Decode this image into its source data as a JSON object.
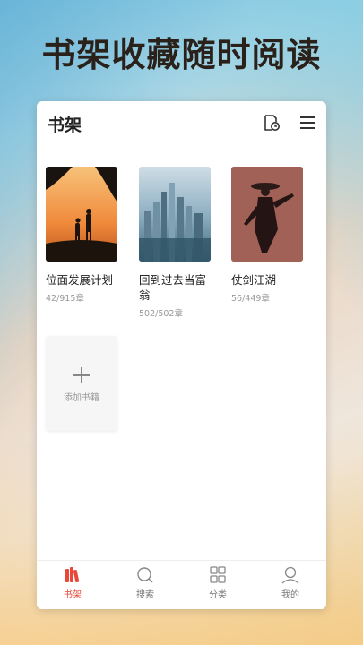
{
  "headline": "书架收藏随时阅读",
  "app": {
    "title": "书架",
    "header_icons": [
      "history-icon",
      "menu-icon"
    ]
  },
  "books": [
    {
      "title": "位面发展计划",
      "progress": "42/915章"
    },
    {
      "title": "回到过去当富翁",
      "progress": "502/502章"
    },
    {
      "title": "仗剑江湖",
      "progress": "56/449章"
    }
  ],
  "add_book": {
    "label": "添加书籍"
  },
  "tabs": [
    {
      "label": "书架",
      "icon": "bookshelf-icon",
      "active": true
    },
    {
      "label": "搜索",
      "icon": "search-icon",
      "active": false
    },
    {
      "label": "分类",
      "icon": "category-grid-icon",
      "active": false
    },
    {
      "label": "我的",
      "icon": "profile-icon",
      "active": false
    }
  ],
  "colors": {
    "accent": "#e8483a",
    "text": "#222222",
    "muted": "#999999"
  }
}
